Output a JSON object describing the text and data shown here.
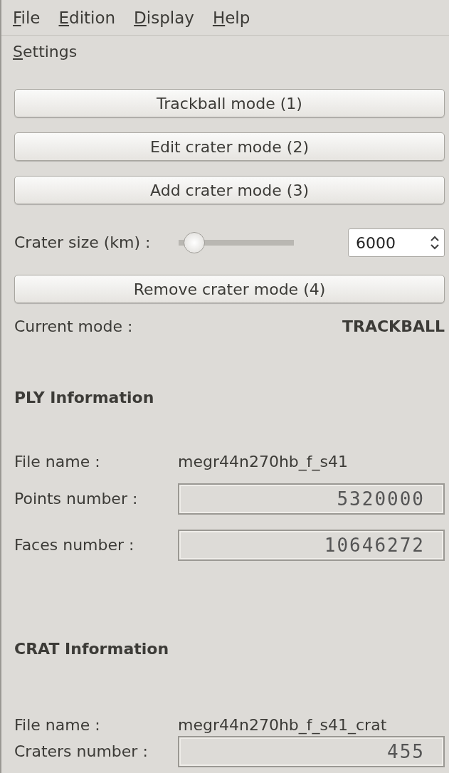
{
  "menu": [
    {
      "label": "File"
    },
    {
      "label": "Edition"
    },
    {
      "label": "Display"
    },
    {
      "label": "Help"
    }
  ],
  "panel_title": "Settings",
  "mode_buttons": [
    "Trackball mode (1)",
    "Edit crater mode (2)",
    "Add crater mode (3)"
  ],
  "crater_size": {
    "label": "Crater size (km) :",
    "level": 0.05,
    "value": "6000"
  },
  "remove_button": "Remove crater mode (4)",
  "current_mode": {
    "label": "Current mode :",
    "value": "TRACKBALL"
  },
  "ply": {
    "heading": "PLY Information",
    "file_label": "File name :",
    "file_name": "megr44n270hb_f_s41",
    "rows": [
      {
        "label": "Points number :",
        "value": "5320000"
      },
      {
        "label": "Faces number :",
        "value": "10646272"
      }
    ]
  },
  "crat": {
    "heading": "CRAT Information",
    "file_label": "File name :",
    "file_name": "megr44n270hb_f_s41_crat",
    "rows": [
      {
        "label": "Craters number :",
        "value": "455"
      }
    ]
  }
}
